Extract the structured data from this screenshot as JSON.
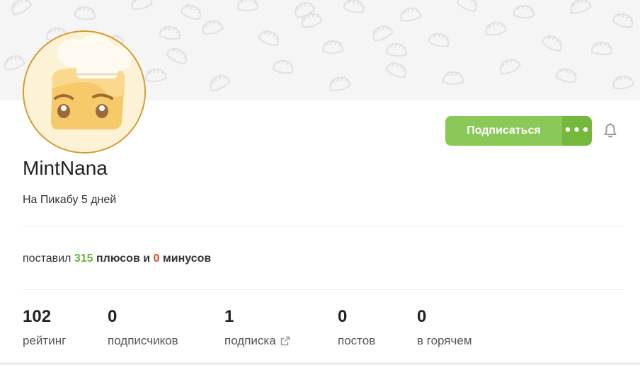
{
  "profile": {
    "username": "MintNana",
    "since": "На Пикабу 5 дней",
    "subscribe_label": "Подписаться",
    "more_label": "•••",
    "avatar_icon": "chef-toast-avatar",
    "bell_icon": "bell-icon"
  },
  "votes": {
    "prefix": "поставил",
    "plus_count": "315",
    "plus_word": "плюсов и",
    "minus_count": "0",
    "minus_word": "минусов"
  },
  "stats": [
    {
      "value": "102",
      "label": "рейтинг"
    },
    {
      "value": "0",
      "label": "подписчиков"
    },
    {
      "value": "1",
      "label": "подписка"
    },
    {
      "value": "0",
      "label": "постов"
    },
    {
      "value": "0",
      "label": "в горячем"
    }
  ],
  "colors": {
    "subscribe": "#8ac858",
    "subscribe_more": "#74b83e",
    "plus": "#6cb33e",
    "minus": "#e0432f",
    "avatar_border": "#d49a2a"
  }
}
